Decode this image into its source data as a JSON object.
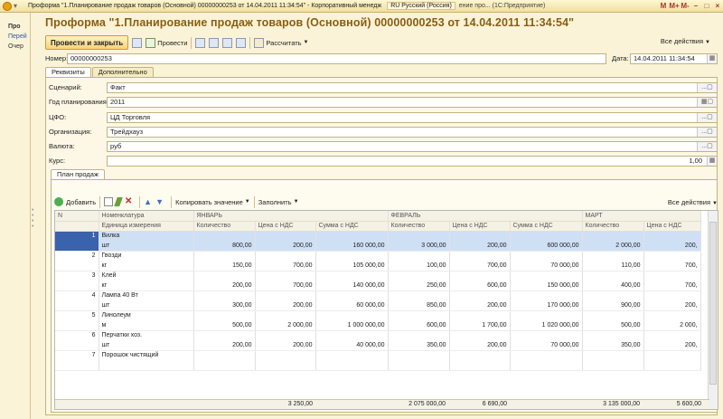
{
  "titlebar": {
    "title": "Проформа \"1.Планирование продаж товаров (Основной) 00000000253 от 14.04.2011 11:34:54\" - Корпоративный менедж",
    "lang": "RU Русский (Россия)",
    "task2": "ение про... (1С:Предприятие)",
    "btns": [
      "M",
      "M+",
      "M-",
      "–",
      "□",
      "×"
    ]
  },
  "left": {
    "title": "Про",
    "link1": "Перей",
    "link2": "Очер"
  },
  "doc": {
    "title": "Проформа \"1.Планирование  продаж товаров (Основной)  00000000253 от 14.04.2011 11:34:54\""
  },
  "toolbar": {
    "post_close": "Провести и закрыть",
    "post": "Провести",
    "calc": "Рассчитать",
    "all_actions": "Все действия"
  },
  "header": {
    "number_label": "Номер:",
    "number": "00000000253",
    "date_label": "Дата:",
    "date": "14.04.2011 11:34:54"
  },
  "tabs": [
    "Реквизиты",
    "Дополнительно"
  ],
  "form": {
    "scenario_label": "Сценарий:",
    "scenario": "Факт",
    "year_label": "Год планирования:",
    "year": "2011",
    "cfo_label": "ЦФО:",
    "cfo": "ЦД Торговля",
    "org_label": "Организация:",
    "org": "Трейдхауз",
    "currency_label": "Валюта:",
    "currency": "руб",
    "rate_label": "Курс:",
    "rate": "1,00"
  },
  "inner_tab": "План продаж",
  "grid_toolbar": {
    "add": "Добавить",
    "copy_value": "Копировать значение",
    "fill": "Заполнить",
    "all_actions": "Все действия"
  },
  "grid": {
    "col_n": "N",
    "col_item": "Номенклатура",
    "col_unit": "Единица измерения",
    "months": [
      "ЯНВАРЬ",
      "ФЕВРАЛЬ",
      "МАРТ"
    ],
    "sub": [
      "Количество",
      "Цена с НДС",
      "Сумма с НДС"
    ],
    "rows": [
      {
        "n": "1",
        "item": "Вилка",
        "unit": "шт",
        "v": [
          "800,00",
          "200,00",
          "160 000,00",
          "3 000,00",
          "200,00",
          "600 000,00",
          "2 000,00",
          "200,"
        ]
      },
      {
        "n": "2",
        "item": "Гвозди",
        "unit": "кг",
        "v": [
          "150,00",
          "700,00",
          "105 000,00",
          "100,00",
          "700,00",
          "70 000,00",
          "110,00",
          "700,"
        ]
      },
      {
        "n": "3",
        "item": "Клей",
        "unit": "кг",
        "v": [
          "200,00",
          "700,00",
          "140 000,00",
          "250,00",
          "600,00",
          "150 000,00",
          "400,00",
          "700,"
        ]
      },
      {
        "n": "4",
        "item": "Лампа 40 Вт",
        "unit": "шт",
        "v": [
          "300,00",
          "200,00",
          "60 000,00",
          "850,00",
          "200,00",
          "170 000,00",
          "900,00",
          "200,"
        ]
      },
      {
        "n": "5",
        "item": "Линолеум",
        "unit": "м",
        "v": [
          "500,00",
          "2 000,00",
          "1 000 000,00",
          "600,00",
          "1 700,00",
          "1 020 000,00",
          "500,00",
          "2 000,"
        ]
      },
      {
        "n": "6",
        "item": "Перчатки хоз.",
        "unit": "шт",
        "v": [
          "200,00",
          "200,00",
          "40 000,00",
          "350,00",
          "200,00",
          "70 000,00",
          "350,00",
          "200,"
        ]
      },
      {
        "n": "7",
        "item": "Порошок чистящий",
        "unit": "",
        "v": [
          "",
          "",
          "",
          "",
          "",
          "",
          "",
          ""
        ]
      }
    ],
    "totals": [
      "3 250,00",
      "2 075 000,00",
      "6 690,00",
      "3 135 000,00",
      "5 600,00"
    ]
  }
}
